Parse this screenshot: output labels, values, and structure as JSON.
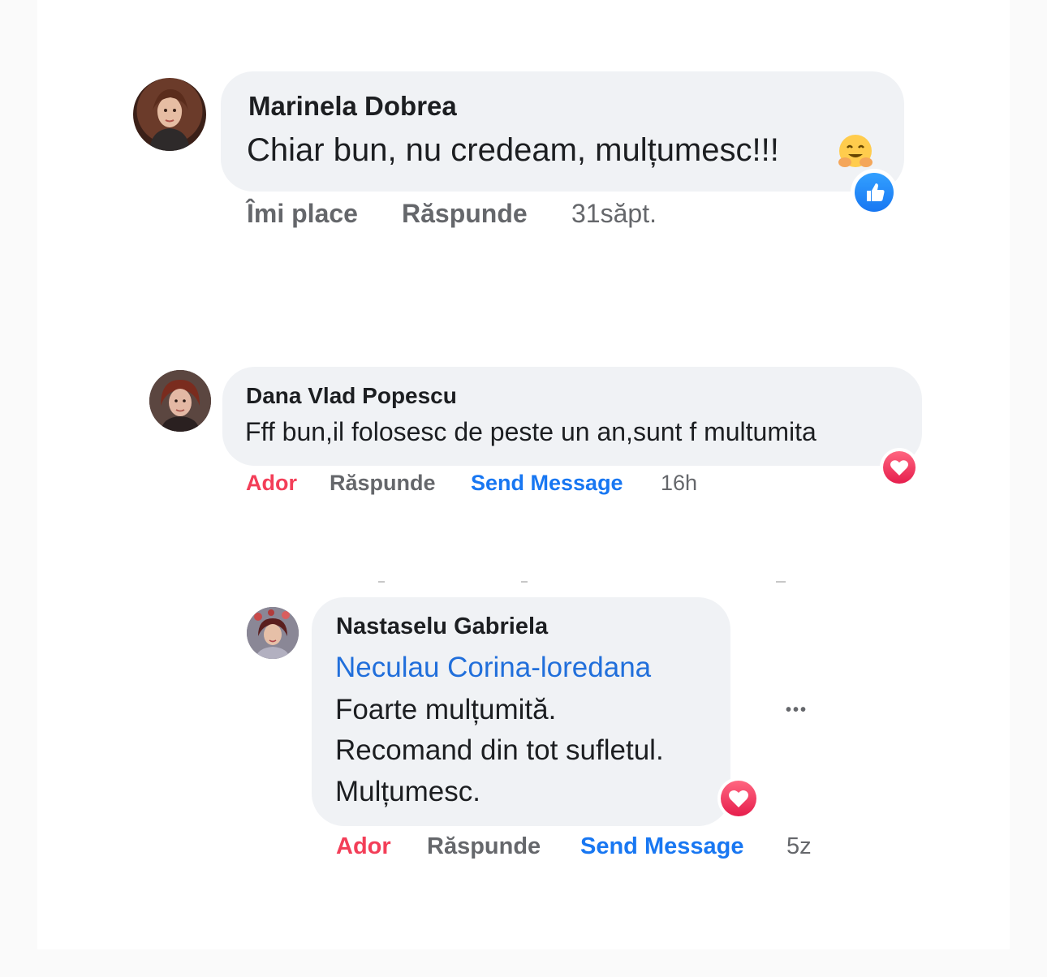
{
  "comments": [
    {
      "author": "Marinela Dobrea",
      "text": "Chiar bun, nu credeam, mulțumesc!!!",
      "emoji": "hugging-face-emoji",
      "reaction": "like",
      "actions": {
        "like": "Îmi place",
        "reply": "Răspunde"
      },
      "time": "31săpt."
    },
    {
      "author": "Dana Vlad Popescu",
      "text": "Fff bun,il folosesc de peste un an,sunt f multumita",
      "reaction": "love",
      "actions": {
        "like": "Ador",
        "reply": "Răspunde",
        "message": "Send Message"
      },
      "time": "16h"
    },
    {
      "author": "Nastaselu Gabriela",
      "mention": "Neculau Corina-loredana",
      "lines": [
        "Foarte mulțumită.",
        "Recomand din tot sufletul.",
        "Mulțumesc."
      ],
      "reaction": "love",
      "actions": {
        "like": "Ador",
        "reply": "Răspunde",
        "message": "Send Message"
      },
      "time": "5z",
      "more": "•••"
    }
  ],
  "colors": {
    "bubble": "#f0f2f5",
    "love_red": "#f33e58",
    "like_blue": "#1877f2",
    "secondary_text": "#65676b"
  }
}
